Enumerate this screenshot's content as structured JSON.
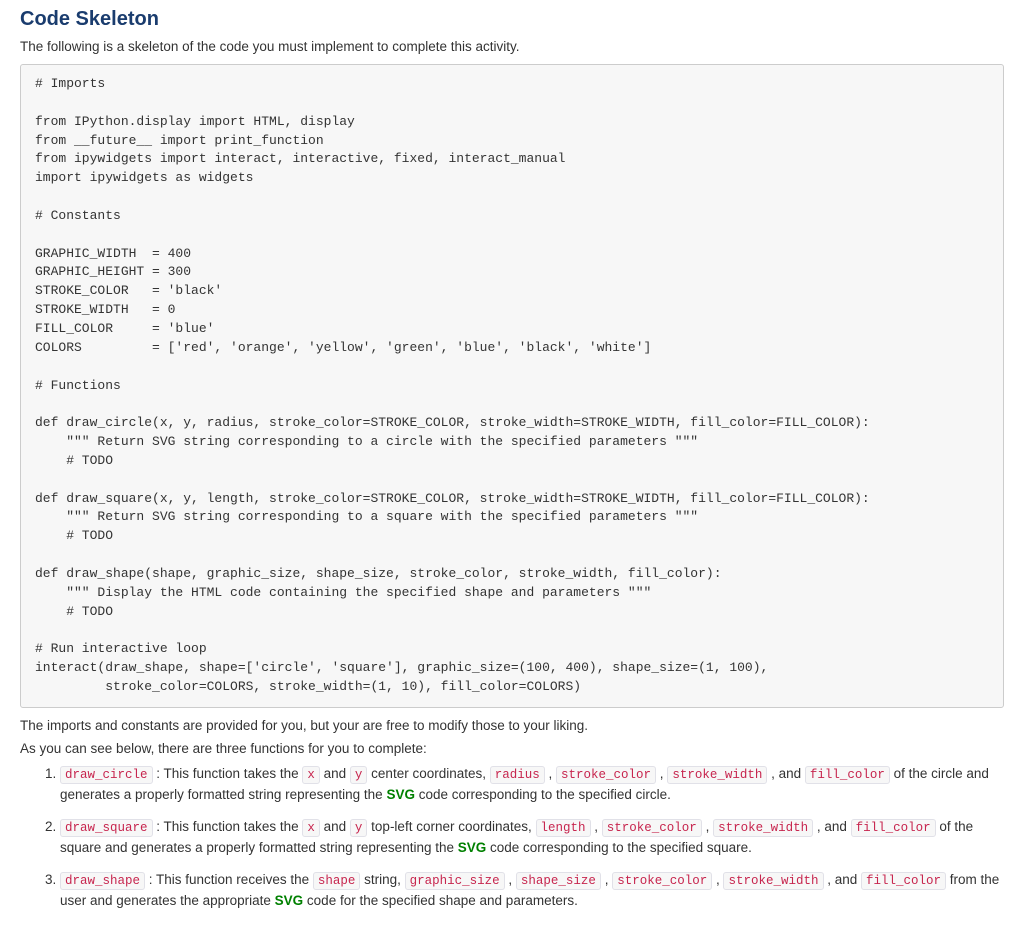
{
  "heading": "Code Skeleton",
  "intro": "The following is a skeleton of the code you must implement to complete this activity.",
  "code": {
    "comment_imports": "# Imports",
    "line_ipython": "from IPython.display import HTML, display",
    "line_future": "from __future__ import print_function",
    "line_ipywidgets1": "from ipywidgets import interact, interactive, fixed, interact_manual",
    "line_ipywidgets2": "import ipywidgets as widgets",
    "comment_constants": "# Constants",
    "const_gw": "GRAPHIC_WIDTH  = 400",
    "const_gh": "GRAPHIC_HEIGHT = 300",
    "const_sc": "STROKE_COLOR   = 'black'",
    "const_sw": "STROKE_WIDTH   = 0",
    "const_fc": "FILL_COLOR     = 'blue'",
    "const_colors": "COLORS         = ['red', 'orange', 'yellow', 'green', 'blue', 'black', 'white']",
    "comment_functions": "# Functions",
    "def_circle": "def draw_circle(x, y, radius, stroke_color=STROKE_COLOR, stroke_width=STROKE_WIDTH, fill_color=FILL_COLOR):",
    "doc_circle": "    \"\"\" Return SVG string corresponding to a circle with the specified parameters \"\"\"",
    "todo_circle": "    # TODO",
    "def_square": "def draw_square(x, y, length, stroke_color=STROKE_COLOR, stroke_width=STROKE_WIDTH, fill_color=FILL_COLOR):",
    "doc_square": "    \"\"\" Return SVG string corresponding to a square with the specified parameters \"\"\"",
    "todo_square": "    # TODO",
    "def_shape": "def draw_shape(shape, graphic_size, shape_size, stroke_color, stroke_width, fill_color):",
    "doc_shape": "    \"\"\" Display the HTML code containing the specified shape and parameters \"\"\"",
    "todo_shape": "    # TODO",
    "comment_run": "# Run interactive loop",
    "run_line1": "interact(draw_shape, shape=['circle', 'square'], graphic_size=(100, 400), shape_size=(1, 100),",
    "run_line2": "         stroke_color=COLORS, stroke_width=(1, 10), fill_color=COLORS)"
  },
  "para1": "The imports and constants are provided for you, but your are free to modify those to your liking.",
  "para2": "As you can see below, there are three functions for you to complete:",
  "items": [
    {
      "fn": "draw_circle",
      "pre": " : This function takes the ",
      "params": [
        "x",
        "y",
        "radius",
        "stroke_color",
        "stroke_width",
        "fill_color"
      ],
      "mid1": " and ",
      "mid2": " center coordinates, ",
      "join": " , ",
      "tailpre": " , and ",
      "tail1": " of the circle and generates a properly formatted string representing the ",
      "svg": "SVG",
      "tail2": " code corresponding to the specified circle."
    },
    {
      "fn": "draw_square",
      "pre": " : This function takes the ",
      "params": [
        "x",
        "y",
        "length",
        "stroke_color",
        "stroke_width",
        "fill_color"
      ],
      "mid1": " and ",
      "mid2": " top-left corner coordinates, ",
      "join": " , ",
      "tailpre": " , and ",
      "tail1": " of the square and generates a properly formatted string representing the ",
      "svg": "SVG",
      "tail2": " code corresponding to the specified square."
    },
    {
      "fn": "draw_shape",
      "pre": " : This function receives the ",
      "params": [
        "shape",
        "graphic_size",
        "shape_size",
        "stroke_color",
        "stroke_width",
        "fill_color"
      ],
      "mid1": "",
      "mid2": " string, ",
      "join": " , ",
      "tailpre": " , and ",
      "tail1": " from the user and generates the appropriate ",
      "svg": "SVG",
      "tail2": " code for the specified shape and parameters."
    }
  ]
}
